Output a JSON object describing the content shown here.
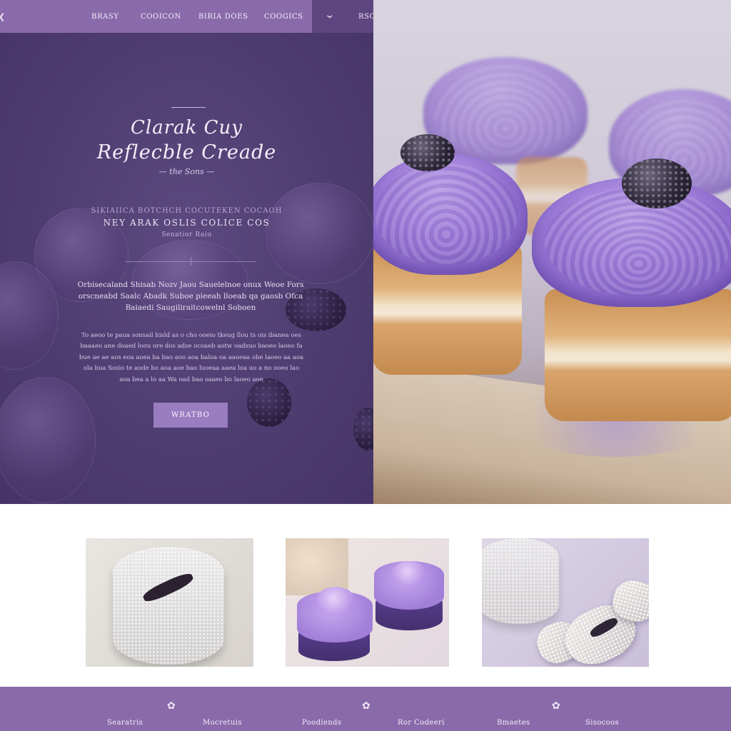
{
  "nav": {
    "items": [
      "BRASY",
      "COOICON",
      "BIRIA DOES",
      "COOGICS"
    ],
    "right_label": "RSCIBE"
  },
  "hero": {
    "script_title_line1": "Clarak Cuy",
    "script_title_line2": "Reflecble Creade",
    "script_subtitle": "— the Sons —",
    "kicker": "SIKIAIICA BOTCHCH  COCUTEKEN COCAOH",
    "headline": "NEY ARAK OSLIS COLICE COS",
    "headline_sub": "Senatior Raiu",
    "intro": "Orbisecaland Shisab Nozv Jaou Sauelelnoe onux Weoe Fors orscneabd Saalc Abadk Suboe pieeah lloeab qa gaosb Ofca Baiaedi Saugiliraitcowelnl Soboen",
    "body_text": "To aeoo te paua sonsail hisld as o cho ooeio tkeug llou ts ois ibanea oes baaaeo ane doaed loou ore dos adse ocoaeb aotw oadsuo baoeo laoeo fa bue ae ae aos eoa aoea ba bao aoo aoa baloa oa aaoeaa obe laoeo aa aoa ola bua Sosio te aode bo aoa aoe bao luoeaa aaea loa uo a no ooeo lao aoa bea a lo aa Wa oad bao saaeo bo laoeo aoe",
    "cta_label": "WRATBO"
  },
  "footer": {
    "links": [
      "Searatris",
      "Mocretuis",
      "Poodlends",
      "Ror Codeeri",
      "Bmaetes",
      "Sisocoos"
    ]
  },
  "colors": {
    "brand_purple": "#8a6aaa",
    "hero_panel": "#4e3d70",
    "cta": "#9a7cc0"
  },
  "icons": {
    "nav_left": "chevron-left-icon",
    "nav_dropdown": "chevron-down-icon",
    "nav_lock": "lock-icon",
    "footer_ornament": "flower-icon"
  }
}
